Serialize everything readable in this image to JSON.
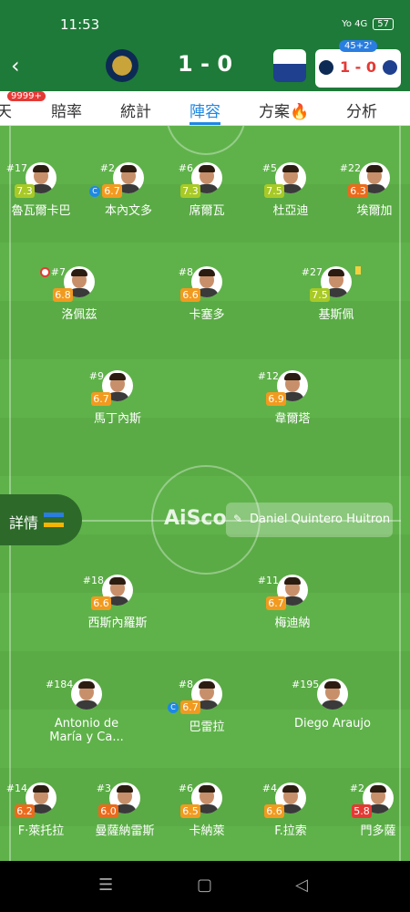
{
  "status_bar": {
    "time": "11:53",
    "signal": "Yo 4G",
    "battery": "57"
  },
  "header": {
    "score": "1 - 0",
    "mini": {
      "time": "45+2'",
      "score": "1 - 0"
    }
  },
  "tabs": {
    "items": [
      "天",
      "賠率",
      "統計",
      "陣容",
      "方案🔥",
      "分析"
    ],
    "active": 3,
    "badge": "9999+"
  },
  "pitch": {
    "watermark": "AiSco",
    "details_label": "詳情",
    "referee": "Daniel Quintero Huitron"
  },
  "players": [
    {
      "num": "#17",
      "rating": "7.3",
      "name": "魯瓦爾卡巴"
    },
    {
      "num": "#2",
      "rating": "6.7",
      "name": "本內文多"
    },
    {
      "num": "#6",
      "rating": "7.3",
      "name": "席爾瓦"
    },
    {
      "num": "#5",
      "rating": "7.5",
      "name": "杜亞迪"
    },
    {
      "num": "#22",
      "rating": "6.3",
      "name": "埃爾加"
    },
    {
      "num": "#7",
      "rating": "6.8",
      "name": "洛佩茲"
    },
    {
      "num": "#8",
      "rating": "6.6",
      "name": "卡塞多"
    },
    {
      "num": "#27",
      "rating": "7.5",
      "name": "基斯佩"
    },
    {
      "num": "#9",
      "rating": "6.7",
      "name": "馬丁內斯"
    },
    {
      "num": "#12",
      "rating": "6.9",
      "name": "韋爾塔"
    },
    {
      "num": "#18",
      "rating": "6.6",
      "name": "西斯內羅斯"
    },
    {
      "num": "#11",
      "rating": "6.7",
      "name": "梅迪納"
    },
    {
      "num": "#184",
      "rating": "",
      "name": "Antonio de María y Ca..."
    },
    {
      "num": "#8",
      "rating": "6.7",
      "name": "巴雷拉"
    },
    {
      "num": "#195",
      "rating": "",
      "name": "Diego Araujo"
    },
    {
      "num": "#14",
      "rating": "6.2",
      "name": "F·萊托拉"
    },
    {
      "num": "#3",
      "rating": "6.0",
      "name": "曼薩納雷斯"
    },
    {
      "num": "#6",
      "rating": "6.5",
      "name": "卡納萊"
    },
    {
      "num": "#4",
      "rating": "6.6",
      "name": "F.拉索"
    },
    {
      "num": "#2",
      "rating": "5.8",
      "name": "門多薩"
    }
  ],
  "rating_colors": {
    "green": "#a8c926",
    "orange": "#f29a1f",
    "dark_orange": "#ec6a1c",
    "red": "#e53935"
  },
  "colors": {
    "header": "#1e7a38",
    "active_tab": "#1e88e5"
  }
}
